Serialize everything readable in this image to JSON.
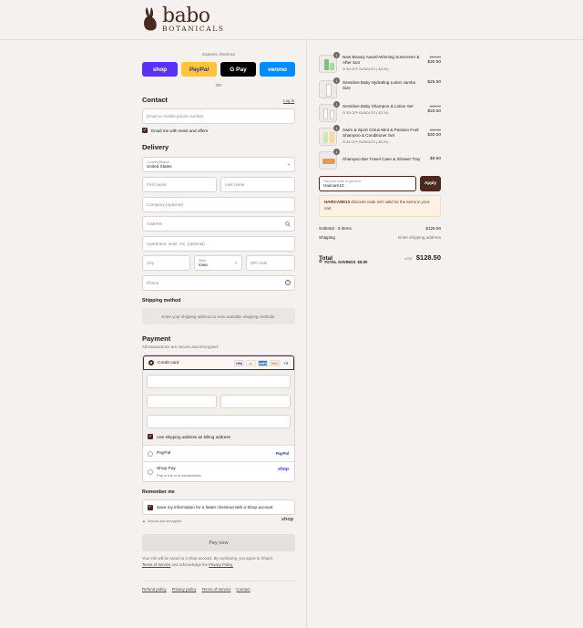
{
  "brand": {
    "name": "babo",
    "sub": "BOTANICALS"
  },
  "express": {
    "title": "Express checkout",
    "shop": "shop",
    "paypal": "PayPal",
    "gpay": "G Pay",
    "venmo": "venmo",
    "or": "OR"
  },
  "contact": {
    "title": "Contact",
    "login": "Log in",
    "email_placeholder": "Email or mobile phone number",
    "news_label": "Email me with news and offers"
  },
  "delivery": {
    "title": "Delivery",
    "country_label": "Country/Region",
    "country_value": "United States",
    "first_name": "First name",
    "last_name": "Last name",
    "company": "Company (optional)",
    "address": "Address",
    "apartment": "Apartment, suite, etc. (optional)",
    "city": "City",
    "state_label": "State",
    "state_value": "Iowa",
    "zip": "ZIP code",
    "phone": "Phone"
  },
  "shipping": {
    "title": "Shipping method",
    "message": "Enter your shipping address to view available shipping methods."
  },
  "payment": {
    "title": "Payment",
    "subtitle": "All transactions are secure and encrypted.",
    "credit_card": "Credit card",
    "more_cards": "+3",
    "billing_label": "Use shipping address as billing address",
    "paypal": "PayPal",
    "shop_pay": "Shop Pay",
    "shop_pay_sub": "Pay in full or in installments",
    "shop_logo": "shop"
  },
  "remember": {
    "title": "Remember me",
    "save_label": "Save my information for a faster checkout with a Shop account",
    "secure": "Secure and encrypted",
    "shop": "shop"
  },
  "pay_now": "Pay now",
  "legal": {
    "line1": "Your info will be saved to a Shop account. By continuing, you agree to Shop's",
    "terms": "Terms of Service",
    "and": "and acknowledge the",
    "privacy": "Privacy Policy."
  },
  "footer_links": [
    "Refund policy",
    "Privacy policy",
    "Terms of service",
    "Contact"
  ],
  "cart": {
    "items": [
      {
        "name": "New Beauty Award-Winning Sunscreen & After Sun",
        "discount": "$3 OFF BUNDLES (-$3.50)",
        "old_price": "$33.99",
        "price": "$30.50",
        "qty": "1"
      },
      {
        "name": "Sensitive Baby Hydrating Lotion Jumbo Size",
        "discount": "",
        "old_price": "",
        "price": "$25.50",
        "qty": "1"
      },
      {
        "name": "Sensitive Baby Shampoo & Lotion Set",
        "discount": "$3 OFF BUNDLES (-$3.00)",
        "old_price": "$36.00",
        "price": "$33.00",
        "qty": "1"
      },
      {
        "name": "Swim & Sport Citrus Mint & Passion Fruit Shampoo & Conditioner Set",
        "discount": "$3 OFF BUNDLES (-$3.00)",
        "old_price": "$33.00",
        "price": "$30.00",
        "qty": "1"
      },
      {
        "name": "Shampoo Bar Travel Case & Shower Tray",
        "discount": "",
        "old_price": "",
        "price": "$9.50",
        "qty": "1"
      }
    ],
    "discount_label": "Discount code or gift card",
    "discount_value": "Haircare10",
    "apply": "Apply",
    "error_code": "HAIRCARE10",
    "error_rest": " discount code isn't valid for the items in your cart",
    "subtotal_label": "Subtotal · 5 items",
    "subtotal_value": "$128.50",
    "shipping_label": "Shipping",
    "shipping_value": "Enter shipping address",
    "total_label": "Total",
    "currency": "USD",
    "total_value": "$128.50",
    "savings_label": "TOTAL SAVINGS",
    "savings_value": "$9.00"
  },
  "colors": {
    "brand": "#4a2a20",
    "shop": "#5a31f4",
    "paypal": "#ffc439",
    "venmo": "#008cff",
    "error_bg": "#fdf1e6"
  }
}
